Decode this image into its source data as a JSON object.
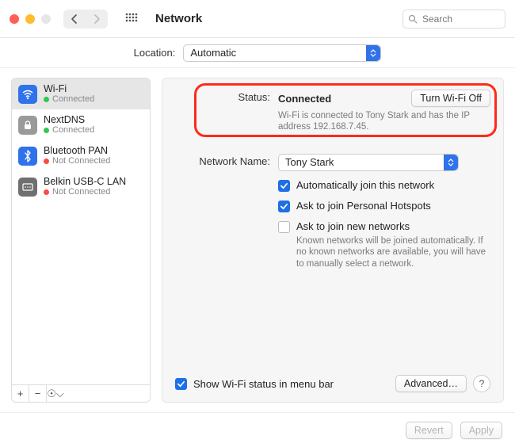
{
  "titlebar": {
    "title": "Network",
    "search_placeholder": "Search"
  },
  "location": {
    "label": "Location:",
    "value": "Automatic"
  },
  "sidebar": {
    "items": [
      {
        "name": "Wi-Fi",
        "status": "Connected"
      },
      {
        "name": "NextDNS",
        "status": "Connected"
      },
      {
        "name": "Bluetooth PAN",
        "status": "Not Connected"
      },
      {
        "name": "Belkin USB-C LAN",
        "status": "Not Connected"
      }
    ],
    "footer": {
      "add": "+",
      "remove": "−",
      "more": "☉⌵"
    }
  },
  "detail": {
    "status_label": "Status:",
    "status_value": "Connected",
    "wifi_toggle": "Turn Wi-Fi Off",
    "status_sub": "Wi-Fi is connected to Tony Stark and has the IP address 192.168.7.45.",
    "netname_label": "Network Name:",
    "netname_value": "Tony Stark",
    "auto_join": "Automatically join this network",
    "ask_hotspot": "Ask to join Personal Hotspots",
    "ask_new": "Ask to join new networks",
    "ask_new_help": "Known networks will be joined automatically. If no known networks are available, you will have to manually select a network.",
    "show_menu": "Show Wi-Fi status in menu bar",
    "advanced": "Advanced…",
    "help": "?"
  },
  "bottom": {
    "revert": "Revert",
    "apply": "Apply"
  }
}
